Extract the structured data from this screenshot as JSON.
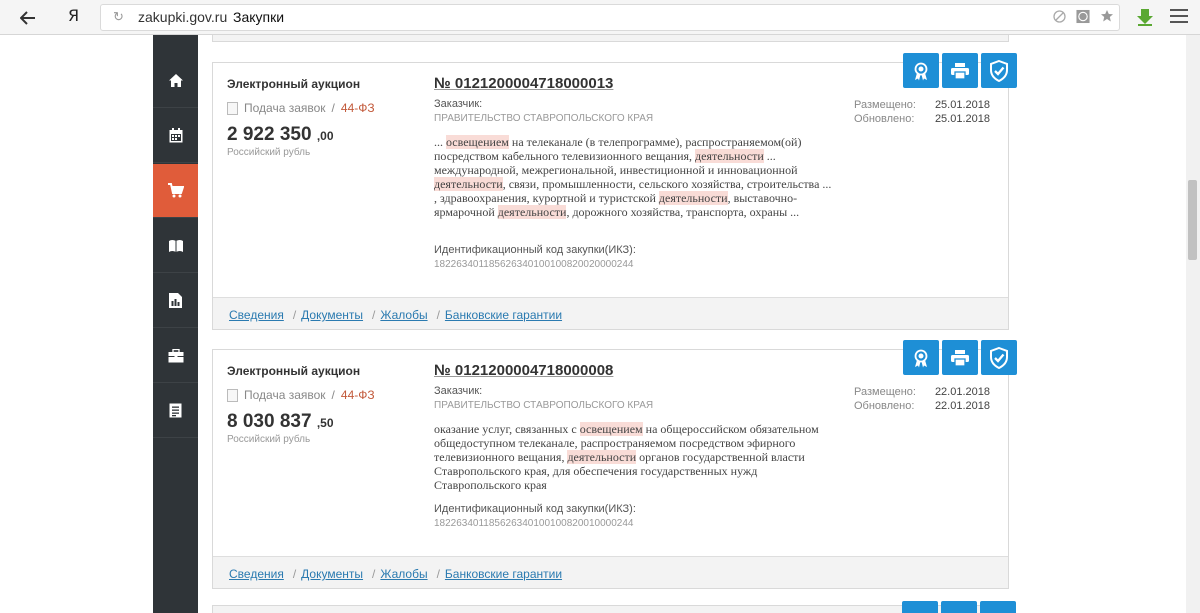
{
  "browser": {
    "logo": "Я",
    "domain": "zakupki.gov.ru",
    "tab_title": "Закупки"
  },
  "colors": {
    "nav_bg": "#2f3438",
    "nav_active": "#e05c3a",
    "action_blue": "#1e8fd6",
    "highlight": "#f9dcd7"
  },
  "sidebar": {
    "items": [
      {
        "icon": "home-icon"
      },
      {
        "icon": "calendar-icon"
      },
      {
        "icon": "cart-icon",
        "active": true
      },
      {
        "icon": "book-icon"
      },
      {
        "icon": "report-icon"
      },
      {
        "icon": "briefcase-icon"
      },
      {
        "icon": "document-list-icon"
      }
    ]
  },
  "cards": [
    {
      "type": "Электронный аукцион",
      "stage": "Подача заявок",
      "law": "44-ФЗ",
      "price_main": "2 922 350",
      "price_kop": ",00",
      "currency": "Российский рубль",
      "number": "№ 0121200004718000013",
      "customer_label": "Заказчик:",
      "customer": "ПРАВИТЕЛЬСТВО СТАВРОПОЛЬСКОГО КРАЯ",
      "description_parts": [
        {
          "t": "... "
        },
        {
          "t": "освещением",
          "hl": true
        },
        {
          "t": " на телеканале (в телепрограмме), распространяемом(ой) посредством кабельного телевизионного вещания, "
        },
        {
          "t": "деятельности",
          "hl": true
        },
        {
          "t": " ... международной, межрегиональной, инвестиционной и инновационной "
        },
        {
          "t": "деятельности",
          "hl": true
        },
        {
          "t": ", связи, промышленности, сельского хозяйства, строительства ... , здравоохранения, курортной и туристской "
        },
        {
          "t": "деятельности",
          "hl": true
        },
        {
          "t": ", выставочно-ярмарочной "
        },
        {
          "t": "деятельности",
          "hl": true
        },
        {
          "t": ", дорожного хозяйства, транспорта, охраны ..."
        }
      ],
      "ikz_label": "Идентификационный код закупки(ИКЗ):",
      "ikz": "182263401185626340100100820020000244",
      "posted_label": "Размещено:",
      "posted": "25.01.2018",
      "updated_label": "Обновлено:",
      "updated": "25.01.2018",
      "links": [
        "Сведения",
        "Документы",
        "Жалобы",
        "Банковские гарантии"
      ]
    },
    {
      "type": "Электронный аукцион",
      "stage": "Подача заявок",
      "law": "44-ФЗ",
      "price_main": "8 030 837",
      "price_kop": ",50",
      "currency": "Российский рубль",
      "number": "№ 0121200004718000008",
      "customer_label": "Заказчик:",
      "customer": "ПРАВИТЕЛЬСТВО СТАВРОПОЛЬСКОГО КРАЯ",
      "description_parts": [
        {
          "t": "оказание услуг, связанных с "
        },
        {
          "t": "освещением",
          "hl": true
        },
        {
          "t": " на общероссийском обязательном общедоступном телеканале, распространяемом посредством эфирного телевизионного вещания, "
        },
        {
          "t": "деятельности",
          "hl": true
        },
        {
          "t": " органов государственной власти Ставропольского края, для обеспечения государственных нужд Ставропольского края"
        }
      ],
      "ikz_label": "Идентификационный код закупки(ИКЗ):",
      "ikz": "182263401185626340100100820010000244",
      "posted_label": "Размещено:",
      "posted": "22.01.2018",
      "updated_label": "Обновлено:",
      "updated": "22.01.2018",
      "links": [
        "Сведения",
        "Документы",
        "Жалобы",
        "Банковские гарантии"
      ]
    }
  ]
}
